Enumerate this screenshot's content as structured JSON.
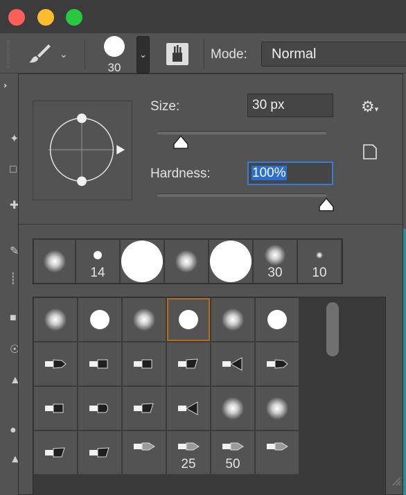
{
  "window": {
    "close_color": "#fc5f57",
    "minimize_color": "#fdbc2e",
    "zoom_color": "#2ac840"
  },
  "options_bar": {
    "tool_icon": "brush-icon",
    "current_brush_size": "30",
    "mode_label": "Mode:",
    "mode_value": "Normal"
  },
  "left_toolbar": {
    "collapse_icon": "double-chevron-icon"
  },
  "brush_picker": {
    "size_label": "Size:",
    "size_value": "30 px",
    "size_fraction": 0.14,
    "hardness_label": "Hardness:",
    "hardness_value": "100%",
    "hardness_fraction": 1.0,
    "gear_icon": "gear-icon",
    "new_preset_icon": "new-preset-icon",
    "recent_brushes": [
      {
        "kind": "soft",
        "label": ""
      },
      {
        "kind": "hard-small",
        "label": "14"
      },
      {
        "kind": "hard-large",
        "label": ""
      },
      {
        "kind": "soft",
        "label": ""
      },
      {
        "kind": "hard-large",
        "label": ""
      },
      {
        "kind": "soft-mid",
        "label": "30"
      },
      {
        "kind": "soft-tiny",
        "label": "10"
      }
    ],
    "preset_rows": [
      [
        {
          "kind": "soft",
          "label": ""
        },
        {
          "kind": "hard",
          "label": ""
        },
        {
          "kind": "soft",
          "label": ""
        },
        {
          "kind": "hard",
          "label": "",
          "selected": true
        },
        {
          "kind": "soft",
          "label": ""
        },
        {
          "kind": "hard",
          "label": ""
        }
      ],
      [
        {
          "kind": "tip-round-point",
          "label": ""
        },
        {
          "kind": "tip-flat",
          "label": ""
        },
        {
          "kind": "tip-flat-round",
          "label": ""
        },
        {
          "kind": "tip-angle",
          "label": ""
        },
        {
          "kind": "tip-fan",
          "label": ""
        },
        {
          "kind": "tip-point",
          "label": ""
        }
      ],
      [
        {
          "kind": "tip-blunt",
          "label": ""
        },
        {
          "kind": "tip-round",
          "label": ""
        },
        {
          "kind": "tip-angle",
          "label": ""
        },
        {
          "kind": "tip-fan-small",
          "label": ""
        },
        {
          "kind": "soft",
          "label": ""
        },
        {
          "kind": "soft",
          "label": ""
        }
      ],
      [
        {
          "kind": "tip-angle",
          "label": ""
        },
        {
          "kind": "tip-angle",
          "label": ""
        },
        {
          "kind": "tip-cone",
          "label": ""
        },
        {
          "kind": "tip-cone",
          "label": "25"
        },
        {
          "kind": "tip-pen",
          "label": "50"
        },
        {
          "kind": "tip-pen",
          "label": ""
        }
      ]
    ]
  }
}
